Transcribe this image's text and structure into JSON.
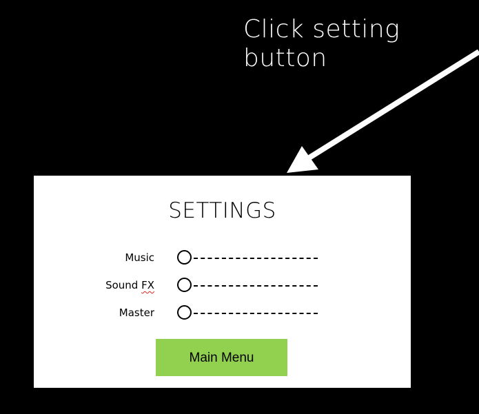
{
  "annotation": {
    "text": "Click setting button"
  },
  "settings": {
    "title": "SETTINGS",
    "rows": [
      {
        "label": "Music",
        "value": 0
      },
      {
        "label_prefix": "Sound ",
        "label_flagged": "FX",
        "value": 0
      },
      {
        "label": "Master",
        "value": 0
      }
    ],
    "main_menu_label": "Main Menu"
  },
  "colors": {
    "background": "#000000",
    "panel": "#ffffff",
    "button": "#92d050",
    "spellcheck_underline": "#e02020"
  },
  "icons": {
    "arrow": "arrow-down-left-icon",
    "slider_knob": "circle-knob-icon"
  }
}
